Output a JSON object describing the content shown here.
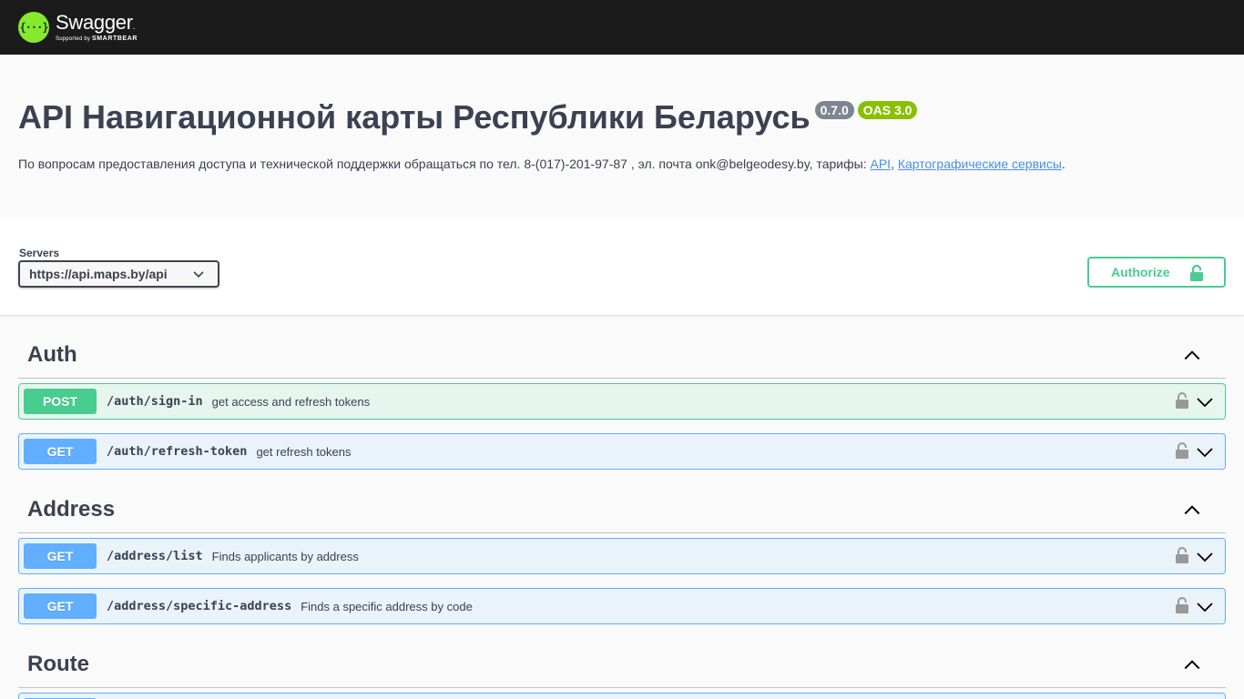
{
  "topbar": {
    "logo_glyph": "{···}",
    "brand": "Swagger",
    "brand_tm": ".",
    "supported_by": "Supported by",
    "smartbear": "SMARTBEAR"
  },
  "info": {
    "title": "API Навигационной карты Республики Беларусь",
    "version": "0.7.0",
    "oas": "OAS 3.0",
    "description_text": "По вопросам предоставления доступа и технической поддержки обращаться по тел. 8-(017)-201-97-87 , эл. почта onk@belgeodesy.by, тарифы: ",
    "link_api": "API",
    "separator": ", ",
    "link_maps": "Картографические сервисы",
    "end": "."
  },
  "servers": {
    "label": "Servers",
    "selected": "https://api.maps.by/api"
  },
  "authorize": {
    "label": "Authorize"
  },
  "tags": [
    {
      "name": "Auth",
      "operations": [
        {
          "method": "POST",
          "path": "/auth/sign-in",
          "summary": "get access and refresh tokens"
        },
        {
          "method": "GET",
          "path": "/auth/refresh-token",
          "summary": "get refresh tokens"
        }
      ]
    },
    {
      "name": "Address",
      "operations": [
        {
          "method": "GET",
          "path": "/address/list",
          "summary": "Finds applicants by address"
        },
        {
          "method": "GET",
          "path": "/address/specific-address",
          "summary": "Finds a specific address by code"
        }
      ]
    },
    {
      "name": "Route",
      "operations": []
    }
  ],
  "colors": {
    "topbar": "#1b1b1b",
    "post": "#49cc90",
    "get": "#61affe",
    "logo": "#85ea2d",
    "version_badge": "#7d8492",
    "oas_badge": "#89bf04"
  },
  "icons": [
    "swagger-logo-icon",
    "chevron-down-icon",
    "lock-icon",
    "chevron-up-icon"
  ]
}
